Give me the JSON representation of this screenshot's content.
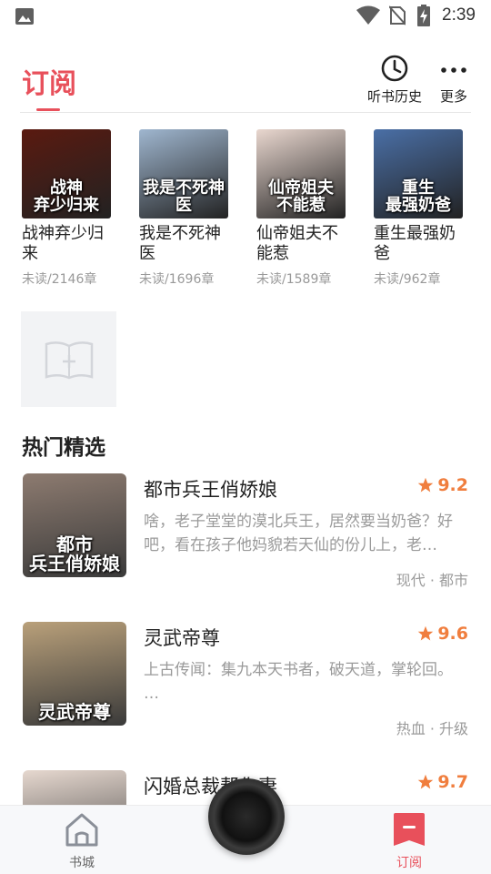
{
  "status_bar": {
    "time": "2:39"
  },
  "header": {
    "title": "订阅",
    "history_label": "听书历史",
    "more_label": "更多"
  },
  "subscribed": [
    {
      "title": "战神弃少归来",
      "meta": "未读/2146章",
      "cover_text": "战神\n弃少归来",
      "cover_color": "#5a1a10"
    },
    {
      "title": "我是不死神医",
      "meta": "未读/1696章",
      "cover_text": "我是不死神医",
      "cover_color": "#9fb6cf"
    },
    {
      "title": "仙帝姐夫不能惹",
      "meta": "未读/1589章",
      "cover_text": "仙帝姐夫\n不能惹",
      "cover_color": "#e9d7cf"
    },
    {
      "title": "重生最强奶爸",
      "meta": "未读/962章",
      "cover_text": "重生\n最强奶爸",
      "cover_color": "#4a6fa6"
    }
  ],
  "section_title": "热门精选",
  "recommended": [
    {
      "title": "都市兵王俏娇娘",
      "score": "9.2",
      "desc": "啥，老子堂堂的漠北兵王，居然要当奶爸？好吧，看在孩子他妈貌若天仙的份儿上，老…",
      "tags": "现代 · 都市",
      "cover_text": "都市\n兵王俏娇娘",
      "cover_color": "#8d7b70"
    },
    {
      "title": "灵武帝尊",
      "score": "9.6",
      "desc": "上古传闻：集九本天书者，破天道，掌轮回。 …",
      "tags": "热血 · 升级",
      "cover_text": "灵武帝尊",
      "cover_color": "#b9a07a"
    },
    {
      "title": "闪婚总裁帮你妻",
      "score": "9.7",
      "desc": "",
      "tags": "",
      "cover_text": "",
      "cover_color": "#e6d8cf"
    }
  ],
  "nav": {
    "home_label": "书城",
    "sub_label": "订阅"
  },
  "colors": {
    "accent": "#e8505b",
    "score": "#f07e3e"
  }
}
